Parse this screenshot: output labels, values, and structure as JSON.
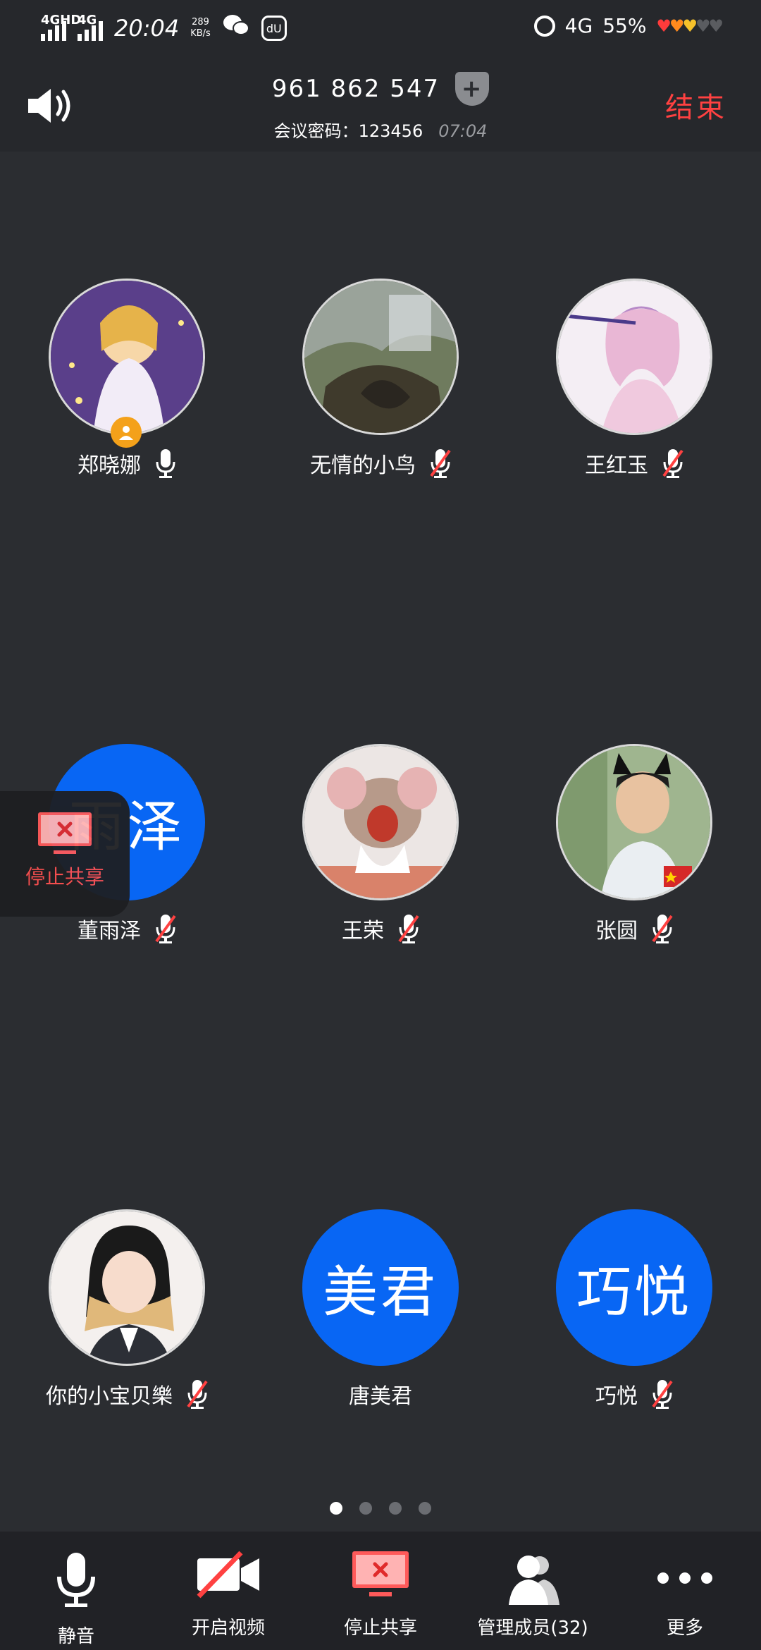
{
  "status_bar": {
    "network1": "4GHD",
    "network2": "4G",
    "time": "20:04",
    "speed": "289",
    "speed_unit": "KB/s",
    "app_icon": "dU",
    "network_right": "4G",
    "battery": "55%",
    "hearts": "♥♥♥♥♥"
  },
  "header": {
    "meeting_id": "961 862 547",
    "password_line": "会议密码：123456",
    "elapsed": "07:04",
    "end_label": "结束",
    "add_symbol": "+"
  },
  "participants": [
    {
      "name": "郑晓娜",
      "avatar_type": "photo",
      "mic": "on",
      "host": true
    },
    {
      "name": "无情的小鸟",
      "avatar_type": "photo",
      "mic": "muted"
    },
    {
      "name": "王红玉",
      "avatar_type": "photo",
      "mic": "muted"
    },
    {
      "name": "董雨泽",
      "avatar_type": "text",
      "avatar_text": "雨泽",
      "mic": "muted"
    },
    {
      "name": "王荣",
      "avatar_type": "photo",
      "mic": "muted"
    },
    {
      "name": "张圆",
      "avatar_type": "photo",
      "mic": "muted"
    },
    {
      "name": "你的小宝贝樂",
      "avatar_type": "photo",
      "mic": "muted"
    },
    {
      "name": "唐美君",
      "avatar_type": "text",
      "avatar_text": "美君",
      "mic": "none"
    },
    {
      "name": "巧悦",
      "avatar_type": "text",
      "avatar_text": "巧悦",
      "mic": "muted"
    }
  ],
  "floating_share": {
    "label": "停止共享"
  },
  "pagination": {
    "total": 4,
    "current": 1
  },
  "toolbar": {
    "mute": "静音",
    "video": "开启视频",
    "share": "停止共享",
    "members": "管理成员(32)",
    "more": "更多"
  },
  "colors": {
    "background": "#2b2d31",
    "accent_blue": "#0866f4",
    "end_red": "#ff4141",
    "host_badge": "#f4a11a"
  }
}
